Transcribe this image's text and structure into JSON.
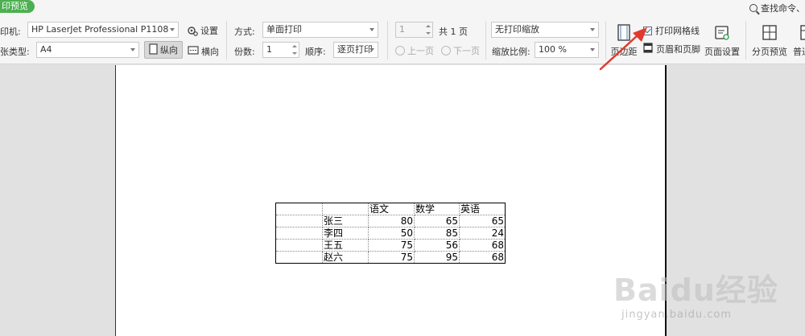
{
  "toolbar": {
    "preview_label": "印预览",
    "search_label": "查找命令、",
    "printer_label": "印机:",
    "printer_value": "HP LaserJet Professional P1108",
    "settings_label": "设置",
    "paper_label": "张类型:",
    "paper_value": "A4",
    "portrait_label": "纵向",
    "landscape_label": "横向",
    "mode_label": "方式:",
    "mode_value": "单面打印",
    "copies_label": "份数:",
    "copies_value": "1",
    "order_label": "顺序:",
    "order_value": "逐页打印",
    "page_value": "1",
    "total_pages": "共 1 页",
    "prev_label": "上一页",
    "next_label": "下一页",
    "scaling_value": "无打印缩放",
    "zoom_label": "缩放比例:",
    "zoom_value": "100 %",
    "margins_label": "页边距",
    "gridlines_label": "打印网格线",
    "header_footer_label": "页眉和页脚",
    "page_setup_label": "页面设置",
    "page_break_label": "分页预览",
    "normal_label": "普通"
  },
  "sheet": {
    "headers": [
      "",
      "语文",
      "数学",
      "英语"
    ],
    "rows": [
      {
        "name": "张三",
        "values": [
          "80",
          "65",
          "65"
        ]
      },
      {
        "name": "李四",
        "values": [
          "50",
          "85",
          "24"
        ]
      },
      {
        "name": "王五",
        "values": [
          "75",
          "56",
          "68"
        ]
      },
      {
        "name": "赵六",
        "values": [
          "75",
          "95",
          "68"
        ]
      }
    ]
  },
  "watermark": {
    "brand": "Baidu经验",
    "url": "jingyan.baidu.com"
  },
  "colors": {
    "accent_green": "#4caf50",
    "arrow_red": "#e03a2f"
  }
}
